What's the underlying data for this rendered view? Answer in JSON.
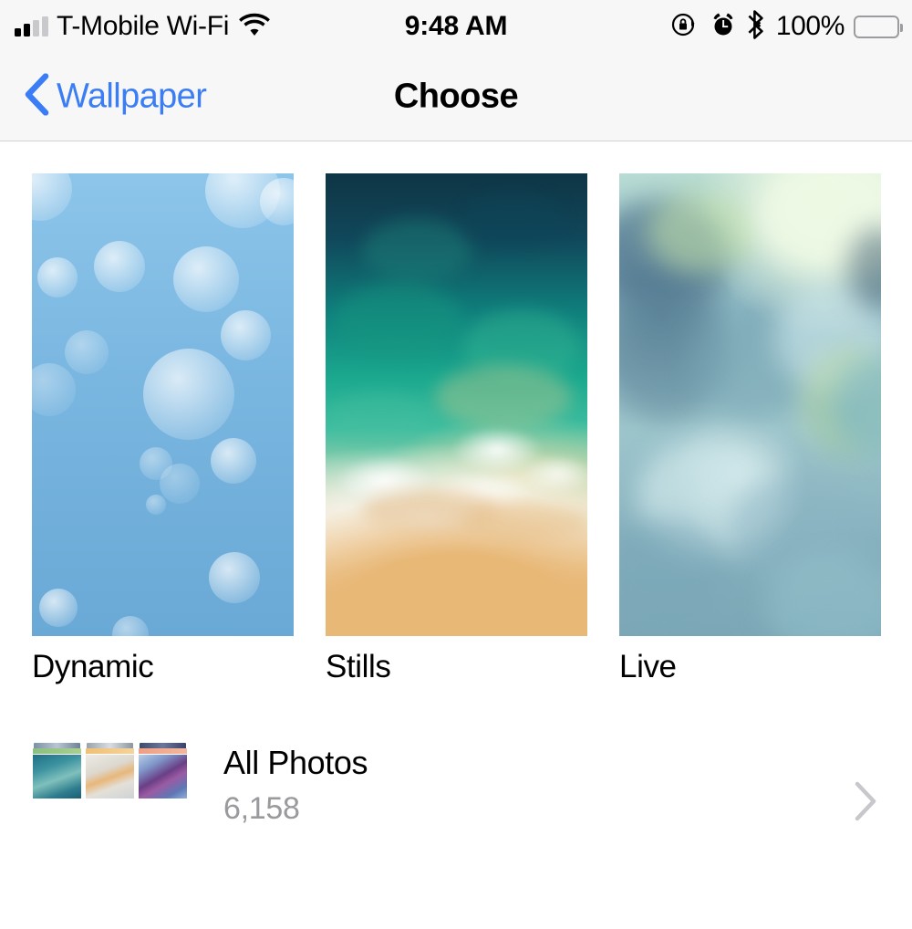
{
  "status_bar": {
    "carrier": "T-Mobile Wi-Fi",
    "signal_bars_filled": 2,
    "signal_bars_total": 4,
    "wifi_icon": "wifi-icon",
    "time": "9:48 AM",
    "rotation_lock_icon": "rotation-lock-icon",
    "alarm_icon": "alarm-clock-icon",
    "bluetooth_icon": "bluetooth-icon",
    "battery_percent": "100%",
    "battery_level": 100
  },
  "nav_bar": {
    "back_icon": "chevron-left-icon",
    "back_label": "Wallpaper",
    "title": "Choose",
    "tint_color": "#3b7df5",
    "background_color": "#f7f7f7"
  },
  "wallpaper_categories": [
    {
      "label": "Dynamic",
      "preview_name": "dynamic-blue-bokeh-preview",
      "preview_colors": [
        "#8dc5ea",
        "#79b6e0",
        "#6aa9d6"
      ]
    },
    {
      "label": "Stills",
      "preview_name": "stills-beach-aerial-preview",
      "preview_colors": [
        "#0f3545",
        "#1aa88e",
        "#ffffff",
        "#e8b877"
      ]
    },
    {
      "label": "Live",
      "preview_name": "live-ink-smoke-preview",
      "preview_colors": [
        "#e9f6e0",
        "#8bb6c2",
        "#567c92"
      ]
    }
  ],
  "all_photos": {
    "title": "All Photos",
    "count": "6,158",
    "thumbnail_stack_name": "all-photos-thumbnail-stack",
    "disclosure_icon": "chevron-right-icon",
    "count_color": "#9a9a9e",
    "disclosure_color": "#c7c7cc"
  }
}
